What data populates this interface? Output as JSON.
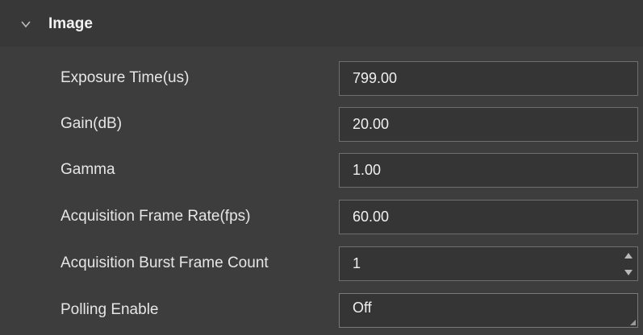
{
  "section": {
    "title": "Image"
  },
  "rows": [
    {
      "label": "Exposure Time(us)",
      "value": "799.00"
    },
    {
      "label": "Gain(dB)",
      "value": "20.00"
    },
    {
      "label": "Gamma",
      "value": "1.00"
    },
    {
      "label": "Acquisition Frame Rate(fps)",
      "value": "60.00"
    },
    {
      "label": "Acquisition Burst Frame Count",
      "value": "1"
    },
    {
      "label": "Polling Enable",
      "value": "Off"
    }
  ],
  "icons": {
    "collapse": "chevron-down-icon",
    "spin_up": "spin-up-icon",
    "spin_down": "spin-down-icon"
  }
}
